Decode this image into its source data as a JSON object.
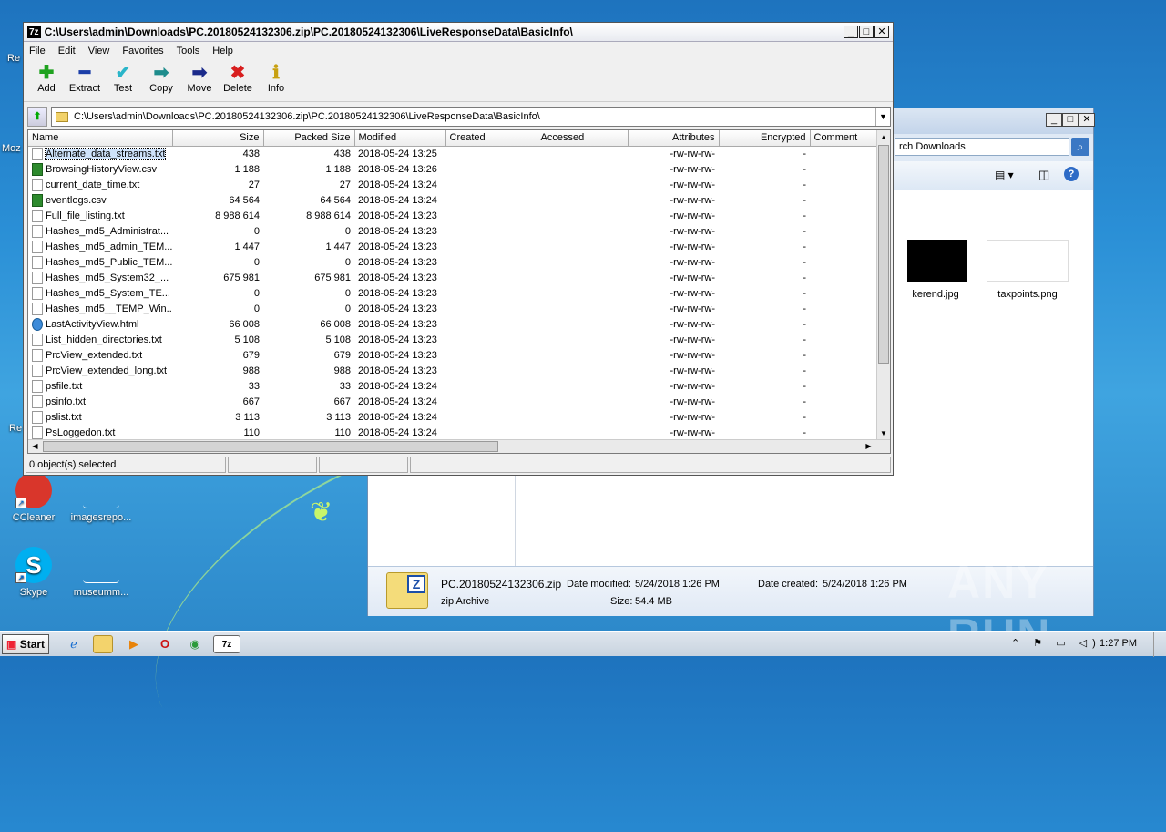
{
  "sevenzip": {
    "title": "C:\\Users\\admin\\Downloads\\PC.20180524132306.zip\\PC.20180524132306\\LiveResponseData\\BasicInfo\\",
    "logo": "7z",
    "menu": [
      "File",
      "Edit",
      "View",
      "Favorites",
      "Tools",
      "Help"
    ],
    "toolbar": [
      "Add",
      "Extract",
      "Test",
      "Copy",
      "Move",
      "Delete",
      "Info"
    ],
    "address": "C:\\Users\\admin\\Downloads\\PC.20180524132306.zip\\PC.20180524132306\\LiveResponseData\\BasicInfo\\",
    "columns": [
      "Name",
      "Size",
      "Packed Size",
      "Modified",
      "Created",
      "Accessed",
      "Attributes",
      "Encrypted",
      "Comment"
    ],
    "rows": [
      [
        "Alternate_data_streams.txt",
        "438",
        "438",
        "2018-05-24 13:25",
        "",
        "",
        "-rw-rw-rw-",
        "-",
        ""
      ],
      [
        "BrowsingHistoryView.csv",
        "1 188",
        "1 188",
        "2018-05-24 13:26",
        "",
        "",
        "-rw-rw-rw-",
        "-",
        ""
      ],
      [
        "current_date_time.txt",
        "27",
        "27",
        "2018-05-24 13:24",
        "",
        "",
        "-rw-rw-rw-",
        "-",
        ""
      ],
      [
        "eventlogs.csv",
        "64 564",
        "64 564",
        "2018-05-24 13:24",
        "",
        "",
        "-rw-rw-rw-",
        "-",
        ""
      ],
      [
        "Full_file_listing.txt",
        "8 988 614",
        "8 988 614",
        "2018-05-24 13:23",
        "",
        "",
        "-rw-rw-rw-",
        "-",
        ""
      ],
      [
        "Hashes_md5_Administrat...",
        "0",
        "0",
        "2018-05-24 13:23",
        "",
        "",
        "-rw-rw-rw-",
        "-",
        ""
      ],
      [
        "Hashes_md5_admin_TEM...",
        "1 447",
        "1 447",
        "2018-05-24 13:23",
        "",
        "",
        "-rw-rw-rw-",
        "-",
        ""
      ],
      [
        "Hashes_md5_Public_TEM...",
        "0",
        "0",
        "2018-05-24 13:23",
        "",
        "",
        "-rw-rw-rw-",
        "-",
        ""
      ],
      [
        "Hashes_md5_System32_...",
        "675 981",
        "675 981",
        "2018-05-24 13:23",
        "",
        "",
        "-rw-rw-rw-",
        "-",
        ""
      ],
      [
        "Hashes_md5_System_TE...",
        "0",
        "0",
        "2018-05-24 13:23",
        "",
        "",
        "-rw-rw-rw-",
        "-",
        ""
      ],
      [
        "Hashes_md5__TEMP_Win...",
        "0",
        "0",
        "2018-05-24 13:23",
        "",
        "",
        "-rw-rw-rw-",
        "-",
        ""
      ],
      [
        "LastActivityView.html",
        "66 008",
        "66 008",
        "2018-05-24 13:23",
        "",
        "",
        "-rw-rw-rw-",
        "-",
        ""
      ],
      [
        "List_hidden_directories.txt",
        "5 108",
        "5 108",
        "2018-05-24 13:23",
        "",
        "",
        "-rw-rw-rw-",
        "-",
        ""
      ],
      [
        "PrcView_extended.txt",
        "679",
        "679",
        "2018-05-24 13:23",
        "",
        "",
        "-rw-rw-rw-",
        "-",
        ""
      ],
      [
        "PrcView_extended_long.txt",
        "988",
        "988",
        "2018-05-24 13:23",
        "",
        "",
        "-rw-rw-rw-",
        "-",
        ""
      ],
      [
        "psfile.txt",
        "33",
        "33",
        "2018-05-24 13:24",
        "",
        "",
        "-rw-rw-rw-",
        "-",
        ""
      ],
      [
        "psinfo.txt",
        "667",
        "667",
        "2018-05-24 13:24",
        "",
        "",
        "-rw-rw-rw-",
        "-",
        ""
      ],
      [
        "pslist.txt",
        "3 113",
        "3 113",
        "2018-05-24 13:24",
        "",
        "",
        "-rw-rw-rw-",
        "-",
        ""
      ],
      [
        "PsLoggedon.txt",
        "110",
        "110",
        "2018-05-24 13:24",
        "",
        "",
        "-rw-rw-rw-",
        "-",
        ""
      ]
    ],
    "file_types": [
      "txt",
      "csv",
      "txt",
      "csv",
      "txt",
      "txt",
      "txt",
      "txt",
      "txt",
      "txt",
      "txt",
      "html",
      "txt",
      "txt",
      "txt",
      "txt",
      "txt",
      "txt",
      "txt"
    ],
    "status": "0 object(s) selected"
  },
  "explorer": {
    "search_text": "rch Downloads",
    "thumbs": [
      "kerend.jpg",
      "taxpoints.png"
    ],
    "details": {
      "filename": "PC.20180524132306.zip",
      "type": "zip Archive",
      "modified_label": "Date modified:",
      "modified": "5/24/2018 1:26 PM",
      "size_label": "Size:",
      "size": "54.4 MB",
      "created_label": "Date created:",
      "created": "5/24/2018 1:26 PM"
    }
  },
  "desktop": {
    "icons": [
      "CCleaner",
      "imagesrepo...",
      "Skype",
      "museumm..."
    ],
    "edge_labels": [
      "Re",
      "Moz",
      "Re"
    ]
  },
  "taskbar": {
    "start": "Start",
    "clock": "1:27 PM"
  },
  "watermark": "ANY RUN"
}
